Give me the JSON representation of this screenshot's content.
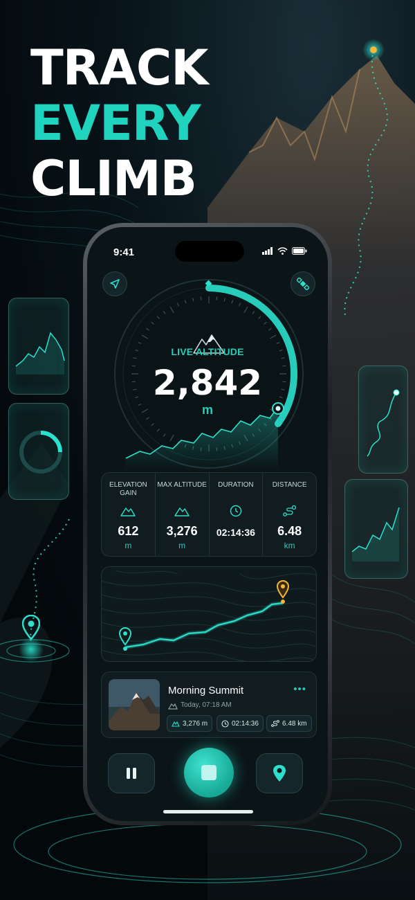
{
  "headline": {
    "line1": "TRACK",
    "line2": "EVERY",
    "line3": "CLIMB"
  },
  "colors": {
    "accent": "#1fd3bf",
    "waypoint": "#f4b73b",
    "background": "#03080b"
  },
  "status_bar": {
    "time": "9:41",
    "icons": [
      "signal-icon",
      "wifi-icon",
      "battery-icon"
    ]
  },
  "top_buttons": {
    "left": "navigation-arrow-icon",
    "right": "satellite-icon"
  },
  "altitude": {
    "label": "LIVE ALTITUDE",
    "value": "2,842",
    "unit": "m"
  },
  "stats": [
    {
      "title": "ELEVATION GAIN",
      "icon": "mountain-icon",
      "value": "612",
      "unit": "m"
    },
    {
      "title": "MAX ALTITUDE",
      "icon": "mountain-icon",
      "value": "3,276",
      "unit": "m"
    },
    {
      "title": "DURATION",
      "icon": "clock-icon",
      "value": "02:14:36",
      "unit": ""
    },
    {
      "title": "DISTANCE",
      "icon": "route-icon",
      "value": "6.48",
      "unit": "km"
    }
  ],
  "activity": {
    "title": "Morning Summit",
    "date": "Today, 07:18 AM",
    "more": "•••",
    "chips": {
      "altitude": "3,276 m",
      "duration": "02:14:36",
      "distance": "6.48 km"
    }
  },
  "controls": {
    "pause": "pause-icon",
    "stop": "stop-icon",
    "pin": "map-pin-icon"
  }
}
